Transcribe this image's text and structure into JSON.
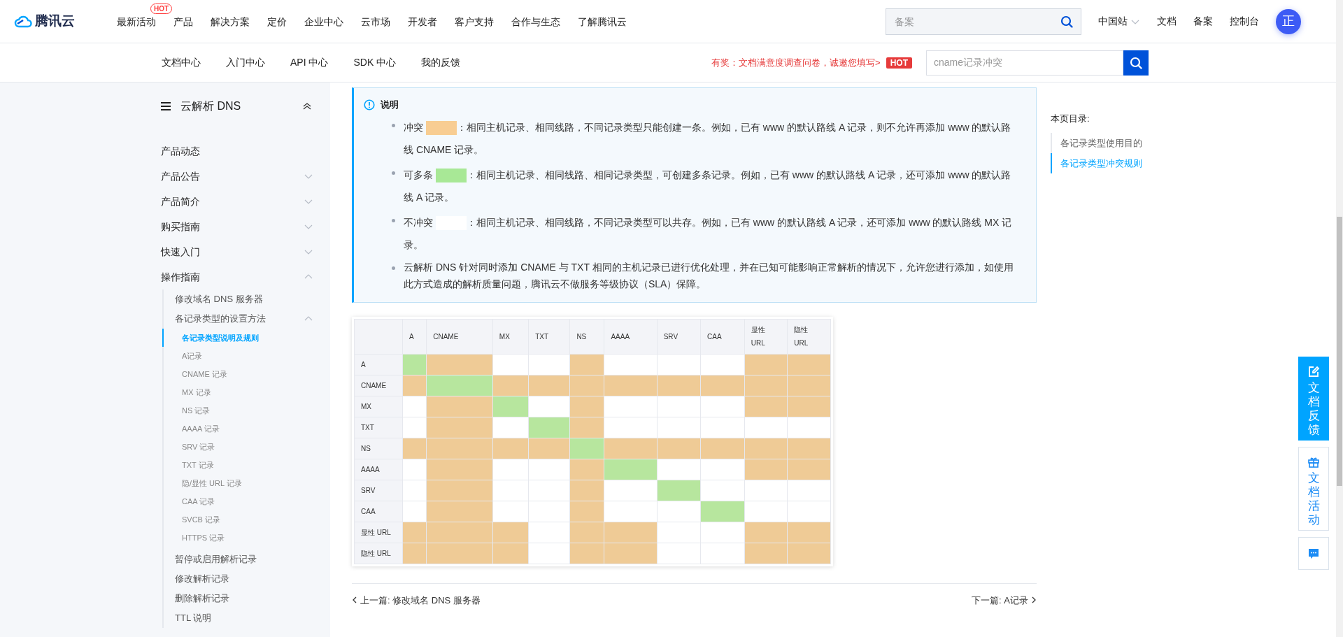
{
  "header": {
    "logo": "腾讯云",
    "nav": [
      {
        "label": "最新活动",
        "badge": "HOT"
      },
      {
        "label": "产品"
      },
      {
        "label": "解决方案"
      },
      {
        "label": "定价"
      },
      {
        "label": "企业中心"
      },
      {
        "label": "云市场"
      },
      {
        "label": "开发者"
      },
      {
        "label": "客户支持"
      },
      {
        "label": "合作与生态"
      },
      {
        "label": "了解腾讯云"
      }
    ],
    "search": {
      "placeholder": "备案"
    },
    "region": "中国站",
    "links": [
      "文档",
      "备案",
      "控制台"
    ],
    "avatar": "正"
  },
  "subnav": {
    "items": [
      "文档中心",
      "入门中心",
      "API 中心",
      "SDK 中心",
      "我的反馈"
    ],
    "promo": "有奖：文档满意度调查问卷，诚邀您填写>",
    "promo_badge": "HOT",
    "search": {
      "value": "cname记录冲突"
    }
  },
  "sidebar": {
    "title": "云解析 DNS",
    "items": [
      {
        "label": "产品动态",
        "selected": false
      },
      {
        "label": "产品公告",
        "expanded": false,
        "selected": false
      },
      {
        "label": "产品简介",
        "expanded": false,
        "selected": false
      },
      {
        "label": "购买指南",
        "expanded": false,
        "selected": false
      },
      {
        "label": "快速入门",
        "expanded": false,
        "selected": false
      },
      {
        "label": "操作指南",
        "expanded": true,
        "selected": false,
        "children": [
          {
            "label": "修改域名 DNS 服务器",
            "selected": false
          },
          {
            "label": "各记录类型的设置方法",
            "expanded": true,
            "selected": false,
            "children": [
              {
                "label": "各记录类型说明及规则",
                "selected": true
              },
              {
                "label": "A记录",
                "selected": false
              },
              {
                "label": "CNAME 记录",
                "selected": false
              },
              {
                "label": "MX 记录",
                "selected": false
              },
              {
                "label": "NS 记录",
                "selected": false
              },
              {
                "label": "AAAA 记录",
                "selected": false
              },
              {
                "label": "SRV 记录",
                "selected": false
              },
              {
                "label": "TXT 记录",
                "selected": false
              },
              {
                "label": "隐/显性 URL 记录",
                "selected": false
              },
              {
                "label": "CAA 记录",
                "selected": false
              },
              {
                "label": "SVCB 记录",
                "selected": false
              },
              {
                "label": "HTTPS 记录",
                "selected": false
              }
            ]
          },
          {
            "label": "暂停或启用解析记录",
            "selected": false
          },
          {
            "label": "修改解析记录",
            "selected": false
          },
          {
            "label": "删除解析记录",
            "selected": false
          },
          {
            "label": "TTL 说明",
            "selected": false
          }
        ]
      }
    ]
  },
  "note": {
    "title": "说明",
    "bullets": [
      {
        "label": "冲突",
        "kind": "conflict",
        "text": "：相同主机记录、相同线路，不同记录类型只能创建一条。例如，已有 www 的默认路线 A 记录，则不允许再添加 www 的默认路线 CNAME 记录。"
      },
      {
        "label": "可多条",
        "kind": "multi",
        "text": "：相同主机记录、相同线路、相同记录类型，可创建多条记录。例如，已有 www 的默认路线 A 记录，还可添加 www 的默认路线 A 记录。"
      },
      {
        "label": "不冲突",
        "kind": "none",
        "text": "：相同主机记录、相同线路，不同记录类型可以共存。例如，已有 www 的默认路线 A 记录，还可添加 www 的默认路线 MX 记录。"
      },
      {
        "kind": "plain",
        "text": "云解析 DNS 针对同时添加 CNAME 与 TXT 相同的主机记录已进行优化处理，并在已知可能影响正常解析的情况下，允许您进行添加，如使用此方式造成的解析质量问题，腾讯云不做服务等级协议（SLA）保障。"
      }
    ]
  },
  "matrix": {
    "columns": [
      "A",
      "CNAME",
      "MX",
      "TXT",
      "NS",
      "AAAA",
      "SRV",
      "CAA",
      "显性\nURL",
      "隐性\nURL"
    ],
    "rows": [
      {
        "label": "A",
        "cells": [
          {
            "kind": "multi"
          },
          {
            "kind": "conflict"
          },
          {
            "kind": "none"
          },
          {
            "kind": "none"
          },
          {
            "kind": "conflict"
          },
          {
            "kind": "none"
          },
          {
            "kind": "none"
          },
          {
            "kind": "none"
          },
          {
            "kind": "conflict"
          },
          {
            "kind": "conflict"
          }
        ]
      },
      {
        "label": "CNAME",
        "cells": [
          {
            "kind": "conflict"
          },
          {
            "kind": "multi"
          },
          {
            "kind": "conflict"
          },
          {
            "kind": "conflict"
          },
          {
            "kind": "conflict"
          },
          {
            "kind": "conflict"
          },
          {
            "kind": "conflict"
          },
          {
            "kind": "conflict"
          },
          {
            "kind": "conflict"
          },
          {
            "kind": "conflict"
          }
        ]
      },
      {
        "label": "MX",
        "cells": [
          {
            "kind": "none"
          },
          {
            "kind": "conflict"
          },
          {
            "kind": "multi"
          },
          {
            "kind": "none"
          },
          {
            "kind": "conflict"
          },
          {
            "kind": "none"
          },
          {
            "kind": "none"
          },
          {
            "kind": "none"
          },
          {
            "kind": "conflict"
          },
          {
            "kind": "conflict"
          }
        ]
      },
      {
        "label": "TXT",
        "cells": [
          {
            "kind": "none"
          },
          {
            "kind": "conflict"
          },
          {
            "kind": "none"
          },
          {
            "kind": "multi"
          },
          {
            "kind": "conflict"
          },
          {
            "kind": "none"
          },
          {
            "kind": "none"
          },
          {
            "kind": "none"
          },
          {
            "kind": "none"
          },
          {
            "kind": "none"
          }
        ]
      },
      {
        "label": "NS",
        "cells": [
          {
            "kind": "conflict"
          },
          {
            "kind": "conflict"
          },
          {
            "kind": "conflict"
          },
          {
            "kind": "conflict"
          },
          {
            "kind": "multi"
          },
          {
            "kind": "conflict"
          },
          {
            "kind": "conflict"
          },
          {
            "kind": "conflict"
          },
          {
            "kind": "conflict"
          },
          {
            "kind": "conflict"
          }
        ]
      },
      {
        "label": "AAAA",
        "cells": [
          {
            "kind": "none"
          },
          {
            "kind": "conflict"
          },
          {
            "kind": "none"
          },
          {
            "kind": "none"
          },
          {
            "kind": "conflict"
          },
          {
            "kind": "multi"
          },
          {
            "kind": "none"
          },
          {
            "kind": "none"
          },
          {
            "kind": "conflict"
          },
          {
            "kind": "conflict"
          }
        ]
      },
      {
        "label": "SRV",
        "cells": [
          {
            "kind": "none"
          },
          {
            "kind": "conflict"
          },
          {
            "kind": "none"
          },
          {
            "kind": "none"
          },
          {
            "kind": "conflict"
          },
          {
            "kind": "none"
          },
          {
            "kind": "multi"
          },
          {
            "kind": "none"
          },
          {
            "kind": "none"
          },
          {
            "kind": "none"
          }
        ]
      },
      {
        "label": "CAA",
        "cells": [
          {
            "kind": "none"
          },
          {
            "kind": "conflict"
          },
          {
            "kind": "none"
          },
          {
            "kind": "none"
          },
          {
            "kind": "conflict"
          },
          {
            "kind": "none"
          },
          {
            "kind": "none"
          },
          {
            "kind": "multi"
          },
          {
            "kind": "none"
          },
          {
            "kind": "none"
          }
        ]
      },
      {
        "label": "显性 URL",
        "cells": [
          {
            "kind": "conflict"
          },
          {
            "kind": "conflict"
          },
          {
            "kind": "conflict"
          },
          {
            "kind": "none"
          },
          {
            "kind": "conflict"
          },
          {
            "kind": "conflict"
          },
          {
            "kind": "none"
          },
          {
            "kind": "none"
          },
          {
            "kind": "conflict"
          },
          {
            "kind": "conflict"
          }
        ]
      },
      {
        "label": "隐性 URL",
        "cells": [
          {
            "kind": "conflict"
          },
          {
            "kind": "conflict"
          },
          {
            "kind": "conflict"
          },
          {
            "kind": "none"
          },
          {
            "kind": "conflict"
          },
          {
            "kind": "conflict"
          },
          {
            "kind": "none"
          },
          {
            "kind": "none"
          },
          {
            "kind": "conflict"
          },
          {
            "kind": "conflict"
          }
        ]
      }
    ]
  },
  "pager": {
    "prev": "上一篇: 修改域名 DNS 服务器",
    "next": "下一篇: A记录"
  },
  "toc": {
    "title": "本页目录:",
    "items": [
      {
        "label": "各记录类型使用目的",
        "selected": false
      },
      {
        "label": "各记录类型冲突规则",
        "selected": true
      }
    ]
  },
  "float_buttons": [
    {
      "kind": "feedback",
      "label": "文档反馈"
    },
    {
      "kind": "activity",
      "label": "文档活动"
    },
    {
      "kind": "chat"
    }
  ]
}
